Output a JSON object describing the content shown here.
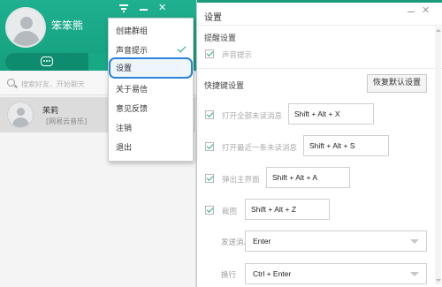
{
  "chat": {
    "username": "笨笨熊",
    "search_placeholder": "搜索好友、开始聊天",
    "contacts": [
      {
        "name": "茉莉",
        "status": "[网易云音乐]"
      }
    ]
  },
  "menu": {
    "items": [
      "创建群组",
      "声音提示",
      "设置",
      "关于易信",
      "意见反馈",
      "注销",
      "退出"
    ],
    "checked_item": "声音提示",
    "highlighted_item": "设置"
  },
  "settings": {
    "title": "设置",
    "reminder_section": "提醒设置",
    "sound_prompt": "声音提示",
    "hotkey_section": "快捷键设置",
    "restore_button": "恢复默认设置",
    "hotkeys": [
      {
        "label": "打开全部未读消息",
        "value": "Shift + Alt + X"
      },
      {
        "label": "打开最近一条未读消息",
        "value": "Shift + Alt + S"
      },
      {
        "label": "弹出主界面",
        "value": "Shift + Alt + A"
      },
      {
        "label": "截图",
        "value": "Shift + Alt + Z"
      }
    ],
    "send_label": "发送消息",
    "send_value": "Enter",
    "newline_label": "换行",
    "newline_value": "Ctrl + Enter"
  },
  "colors": {
    "brand_green": "#14a07f",
    "highlight_blue": "#2c82d8"
  }
}
